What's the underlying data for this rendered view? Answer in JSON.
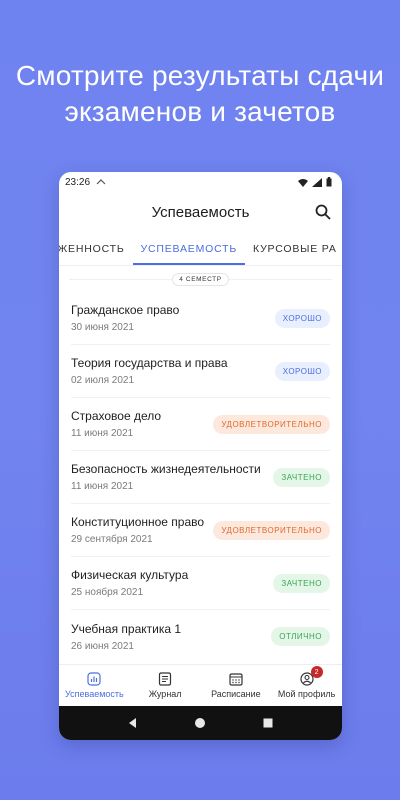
{
  "headline": {
    "line1": "Смотрите результаты сдачи",
    "line2": "экзаменов и зачетов"
  },
  "status_bar": {
    "time": "23:26"
  },
  "app_bar": {
    "title": "Успеваемость",
    "search_icon": "search-icon"
  },
  "tabs": [
    {
      "label": "ОЛЖЕННОСТЬ",
      "active": false
    },
    {
      "label": "УСПЕВАЕМОСТЬ",
      "active": true
    },
    {
      "label": "КУРСОВЫЕ РА",
      "active": false
    }
  ],
  "semester_label": "4 СЕМЕСТР",
  "subjects": [
    {
      "name": "Гражданское право",
      "date": "30 июня 2021",
      "grade": "ХОРОШО",
      "kind": "good"
    },
    {
      "name": "Теория государства и права",
      "date": "02 июля 2021",
      "grade": "ХОРОШО",
      "kind": "good"
    },
    {
      "name": "Страховое дело",
      "date": "11 июня 2021",
      "grade": "УДОВЛЕТВОРИТЕЛЬНО",
      "kind": "sat"
    },
    {
      "name": "Безопасность жизнедеятельности",
      "date": "11 июня 2021",
      "grade": "ЗАЧТЕНО",
      "kind": "pass"
    },
    {
      "name": "Конституционное право",
      "date": "29 сентября 2021",
      "grade": "УДОВЛЕТВОРИТЕЛЬНО",
      "kind": "sat"
    },
    {
      "name": "Физическая культура",
      "date": "25 ноября 2021",
      "grade": "ЗАЧТЕНО",
      "kind": "pass"
    },
    {
      "name": "Учебная практика 1",
      "date": "26 июня 2021",
      "grade": "ОТЛИЧНО",
      "kind": "exc"
    }
  ],
  "bottom_nav": [
    {
      "label": "Успеваемость",
      "icon": "chart-icon",
      "active": true
    },
    {
      "label": "Журнал",
      "icon": "journal-icon",
      "active": false
    },
    {
      "label": "Расписание",
      "icon": "calendar-icon",
      "active": false
    },
    {
      "label": "Мой профиль",
      "icon": "profile-icon",
      "active": false,
      "badge": "2"
    }
  ],
  "colors": {
    "accent": "#4b6ee0",
    "background": "#7184ef",
    "good": "#4b6ee0",
    "satisfactory": "#e06a2c",
    "pass": "#3aa556"
  }
}
